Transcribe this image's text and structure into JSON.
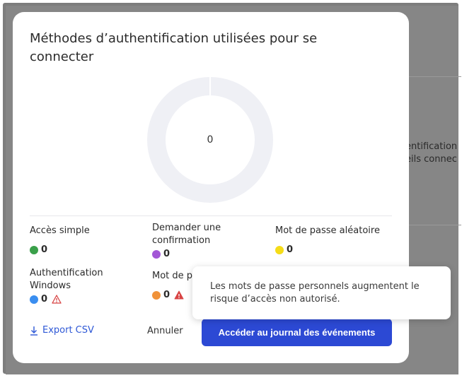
{
  "background": {
    "text_line1": "entification",
    "text_line2": "eils connec"
  },
  "modal": {
    "title": "Méthodes d’authentification utilisées pour se connecter",
    "donut_center": "0",
    "legend": [
      {
        "label": "Accès simple",
        "value": "0",
        "color": "#3aa04a",
        "warning": false
      },
      {
        "label": "Demander une confirmation",
        "value": "0",
        "color": "#a357d6",
        "warning": false
      },
      {
        "label": "Mot de passe aléatoire",
        "value": "0",
        "color": "#f5dc18",
        "warning": false
      },
      {
        "label": "Authentification Windows",
        "value": "0",
        "color": "#3a8ef0",
        "warning": true
      },
      {
        "label": "Mot de p",
        "value": "0",
        "color": "#f0923a",
        "warning": true
      }
    ],
    "export_label": "Export CSV",
    "cancel_label": "Annuler",
    "primary_label": "Accéder au journal des événements"
  },
  "tooltip": {
    "text": "Les mots de passe personnels augmentent le risque d’accès non autorisé."
  },
  "colors": {
    "accent": "#2c49d4",
    "link": "#2e58d6",
    "donut": "#eff0f5",
    "warning": "#d84444"
  }
}
